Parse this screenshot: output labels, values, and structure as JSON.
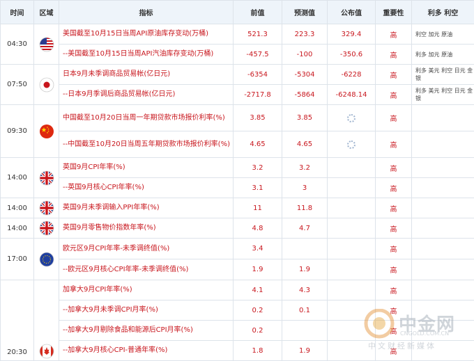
{
  "headers": {
    "time": "时间",
    "region": "区域",
    "indicator": "指标",
    "previous": "前值",
    "forecast": "预测值",
    "actual": "公布值",
    "importance": "重要性",
    "effect": "利多 利空"
  },
  "rows": [
    {
      "time": "04:30",
      "flag": "us",
      "indicator": "美国截至10月15日当周API原油库存变动(万桶)",
      "previous": "521.3",
      "forecast": "223.3",
      "actual": "329.4",
      "importance": "高",
      "effect": "利空 加元 原油"
    },
    {
      "time": "",
      "flag": "",
      "indicator": "--美国截至10月15日当周API汽油库存变动(万桶)",
      "previous": "-457.5",
      "forecast": "-100",
      "actual": "-350.6",
      "importance": "高",
      "effect": "利多 加元 原油"
    },
    {
      "time": "07:50",
      "flag": "jp",
      "indicator": "日本9月未季调商品贸易帐(亿日元)",
      "previous": "-6354",
      "forecast": "-5304",
      "actual": "-6228",
      "importance": "高",
      "effect": "利多 美元 利空 日元 金银"
    },
    {
      "time": "",
      "flag": "",
      "indicator": "--日本9月季调后商品贸易帐(亿日元)",
      "previous": "-2717.8",
      "forecast": "-5864",
      "actual": "-6248.14",
      "importance": "高",
      "effect": "利多 美元 利空 日元 金银"
    },
    {
      "time": "09:30",
      "flag": "cn",
      "indicator": "中国截至10月20日当周一年期贷款市场报价利率(%)",
      "previous": "3.85",
      "forecast": "3.85",
      "actual": "",
      "importance": "高",
      "effect": ""
    },
    {
      "time": "",
      "flag": "",
      "indicator": "--中国截至10月20日当周五年期贷款市场报价利率(%)",
      "previous": "4.65",
      "forecast": "4.65",
      "actual": "",
      "importance": "高",
      "effect": ""
    },
    {
      "time": "14:00",
      "flag": "uk",
      "indicator": "英国9月CPI年率(%)",
      "previous": "3.2",
      "forecast": "3.2",
      "actual": "",
      "importance": "高",
      "effect": ""
    },
    {
      "time": "",
      "flag": "",
      "indicator": "--英国9月核心CPI年率(%)",
      "previous": "3.1",
      "forecast": "3",
      "actual": "",
      "importance": "高",
      "effect": ""
    },
    {
      "time": "14:00",
      "flag": "uk",
      "indicator": "英国9月未季调输入PPI年率(%)",
      "previous": "11",
      "forecast": "11.8",
      "actual": "",
      "importance": "高",
      "effect": ""
    },
    {
      "time": "14:00",
      "flag": "uk",
      "indicator": "英国9月零售物价指数年率(%)",
      "previous": "4.8",
      "forecast": "4.7",
      "actual": "",
      "importance": "高",
      "effect": ""
    },
    {
      "time": "17:00",
      "flag": "eu",
      "indicator": "欧元区9月CPI年率-未季调终值(%)",
      "previous": "3.4",
      "forecast": "",
      "actual": "",
      "importance": "高",
      "effect": ""
    },
    {
      "time": "",
      "flag": "",
      "indicator": "--欧元区9月核心CPI年率-未季调终值(%)",
      "previous": "1.9",
      "forecast": "1.9",
      "actual": "",
      "importance": "高",
      "effect": ""
    },
    {
      "time": "",
      "flag": "",
      "indicator": "加拿大9月CPI年率(%)",
      "previous": "4.1",
      "forecast": "4.3",
      "actual": "",
      "importance": "高",
      "effect": ""
    },
    {
      "time": "",
      "flag": "",
      "indicator": "--加拿大9月未季调CPI月率(%)",
      "previous": "0.2",
      "forecast": "0.1",
      "actual": "",
      "importance": "高",
      "effect": ""
    },
    {
      "time": "",
      "flag": "",
      "indicator": "--加拿大9月剔除食品和能源后CPI月率(%)",
      "previous": "0.2",
      "forecast": "",
      "actual": "",
      "importance": "高",
      "effect": ""
    },
    {
      "time": "20:30",
      "flag": "ca",
      "indicator": "--加拿大9月核心CPI-普通年率(%)",
      "previous": "1.8",
      "forecast": "1.9",
      "actual": "",
      "importance": "高",
      "effect": ""
    }
  ],
  "watermark": {
    "brand": "中金网",
    "url": "CNGOLD.COM.CN",
    "tagline": "中文财经新媒体"
  },
  "colors": {
    "accent_red": "#c8161d",
    "header_bg": "#eef4fa",
    "border": "#dde3ea"
  }
}
